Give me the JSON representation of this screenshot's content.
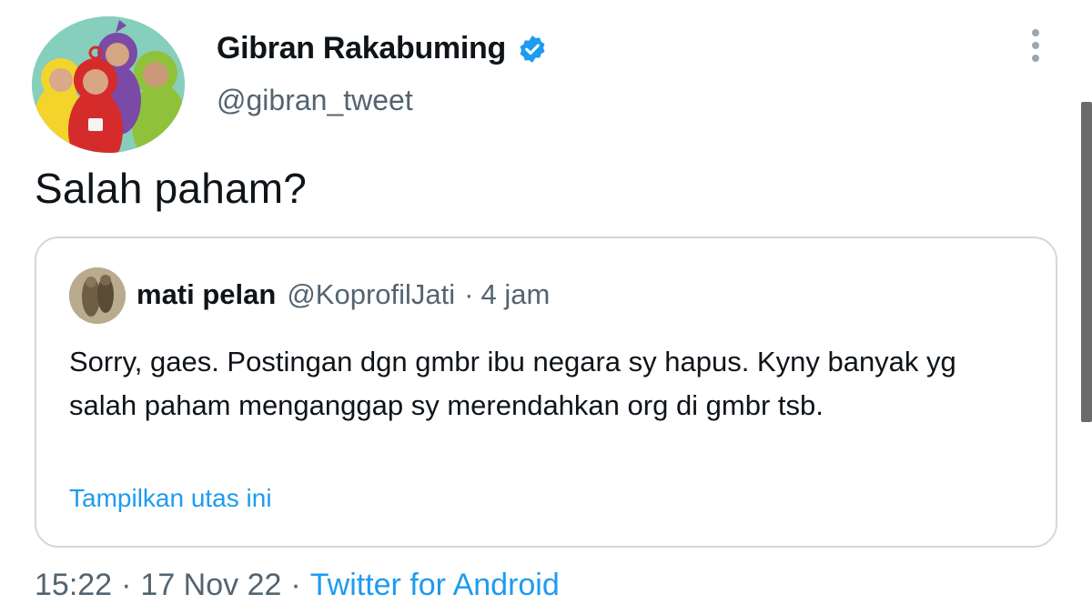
{
  "tweet": {
    "author_name": "Gibran Rakabuming",
    "author_handle": "@gibran_tweet",
    "verified": true,
    "text": "Salah paham?",
    "time": "15:22",
    "date": "17 Nov 22",
    "separator": "·",
    "source": "Twitter for Android"
  },
  "quote": {
    "author_name": "mati pelan",
    "author_handle": "@KoprofilJati",
    "separator": "·",
    "time_ago": "4 jam",
    "text": "Sorry, gaes. Postingan dgn gmbr ibu negara sy hapus. Kyny banyak yg salah paham menganggap sy merendahkan org di gmbr tsb.",
    "show_thread_label": "Tampilkan utas ini"
  },
  "icons": {
    "verified": "verified-badge-icon",
    "more": "more-vertical-icon"
  },
  "colors": {
    "accent": "#1d9bf0",
    "text_primary": "#0f1419",
    "text_secondary": "#536471",
    "border": "#cfd9de"
  }
}
